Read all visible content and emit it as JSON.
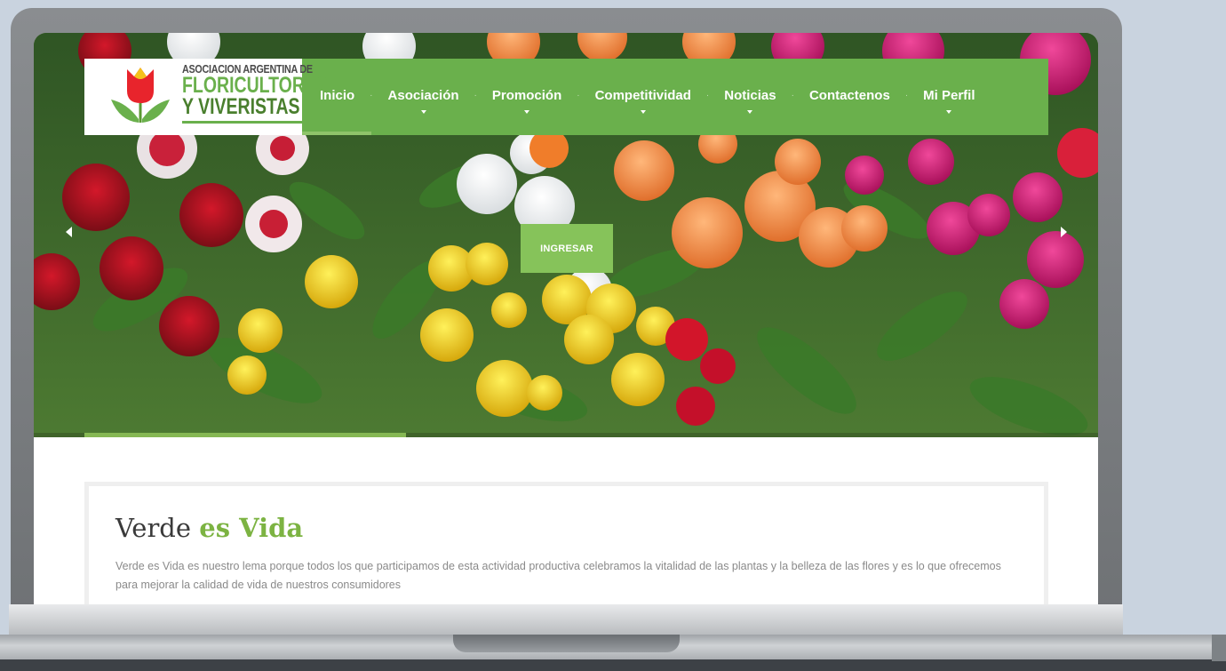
{
  "logo": {
    "line1": "ASOCIACION ARGENTINA DE",
    "line2": "FLORICULTORES",
    "line3": "Y VIVERISTAS"
  },
  "nav": {
    "items": [
      {
        "label": "Inicio",
        "has_dropdown": false
      },
      {
        "label": "Asociación",
        "has_dropdown": true
      },
      {
        "label": "Promoción",
        "has_dropdown": true
      },
      {
        "label": "Competitividad",
        "has_dropdown": true
      },
      {
        "label": "Noticias",
        "has_dropdown": true
      },
      {
        "label": "Contactenos",
        "has_dropdown": false
      },
      {
        "label": "Mi Perfil",
        "has_dropdown": true
      }
    ]
  },
  "hero": {
    "button_label": "INGRESAR",
    "prev_icon": "chevron-left-icon",
    "next_icon": "chevron-right-icon"
  },
  "section": {
    "title_part1": "Verde ",
    "title_part2": "es Vida",
    "text": "Verde es Vida es nuestro lema porque todos los que participamos de esta actividad productiva celebramos la vitalidad de las plantas y la belleza de las flores y es lo que ofrecemos para mejorar la calidad de vida de nuestros consumidores"
  },
  "colors": {
    "nav_green": "#6ab04c",
    "accent_green": "#7cb342",
    "button_green": "#86c35a",
    "text_gray": "#8a8a8a"
  }
}
